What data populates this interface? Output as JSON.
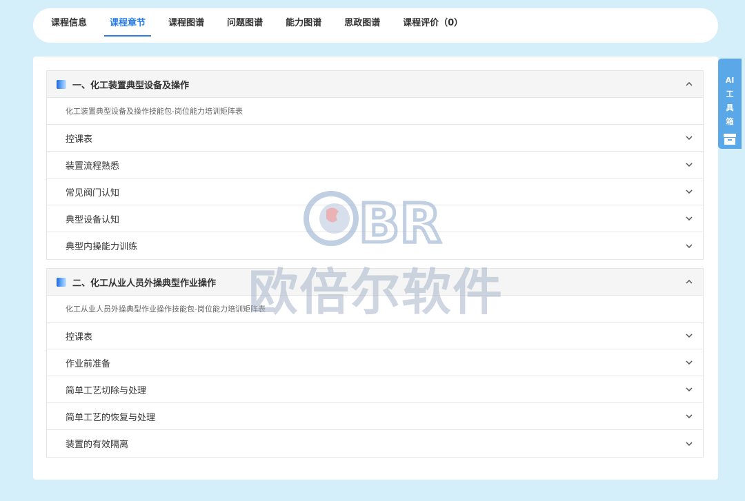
{
  "tabs": [
    {
      "label": "课程信息",
      "active": false
    },
    {
      "label": "课程章节",
      "active": true
    },
    {
      "label": "课程图谱",
      "active": false
    },
    {
      "label": "问题图谱",
      "active": false
    },
    {
      "label": "能力图谱",
      "active": false
    },
    {
      "label": "思政图谱",
      "active": false
    },
    {
      "label": "课程评价（0）",
      "active": false
    }
  ],
  "sections": [
    {
      "title": "一、化工装置典型设备及操作",
      "expanded": true,
      "description": "化工装置典型设备及操作技能包-岗位能力培训矩阵表",
      "items": [
        "控课表",
        "装置流程熟悉",
        "常见阀门认知",
        "典型设备认知",
        "典型内操能力训练"
      ]
    },
    {
      "title": "二、化工从业人员外操典型作业操作",
      "expanded": true,
      "description": "化工从业人员外操典型作业操作技能包-岗位能力培训矩阵表",
      "items": [
        "控课表",
        "作业前准备",
        "简单工艺切除与处理",
        "简单工艺的恢复与处理",
        "装置的有效隔离"
      ]
    }
  ],
  "watermark": {
    "logo_text": "BR",
    "text": "欧倍尔软件"
  },
  "ai_tool": {
    "label": "AI工具箱"
  },
  "colors": {
    "accent": "#2b7de9",
    "page_bg": "#d4eefa",
    "ai_tool_bg": "#5ba8e8"
  },
  "icons": {
    "section_icon": "book-icon",
    "expand": "chevron-up-icon",
    "collapse": "chevron-down-icon",
    "ai_tool_icon": "toolbox-icon"
  }
}
